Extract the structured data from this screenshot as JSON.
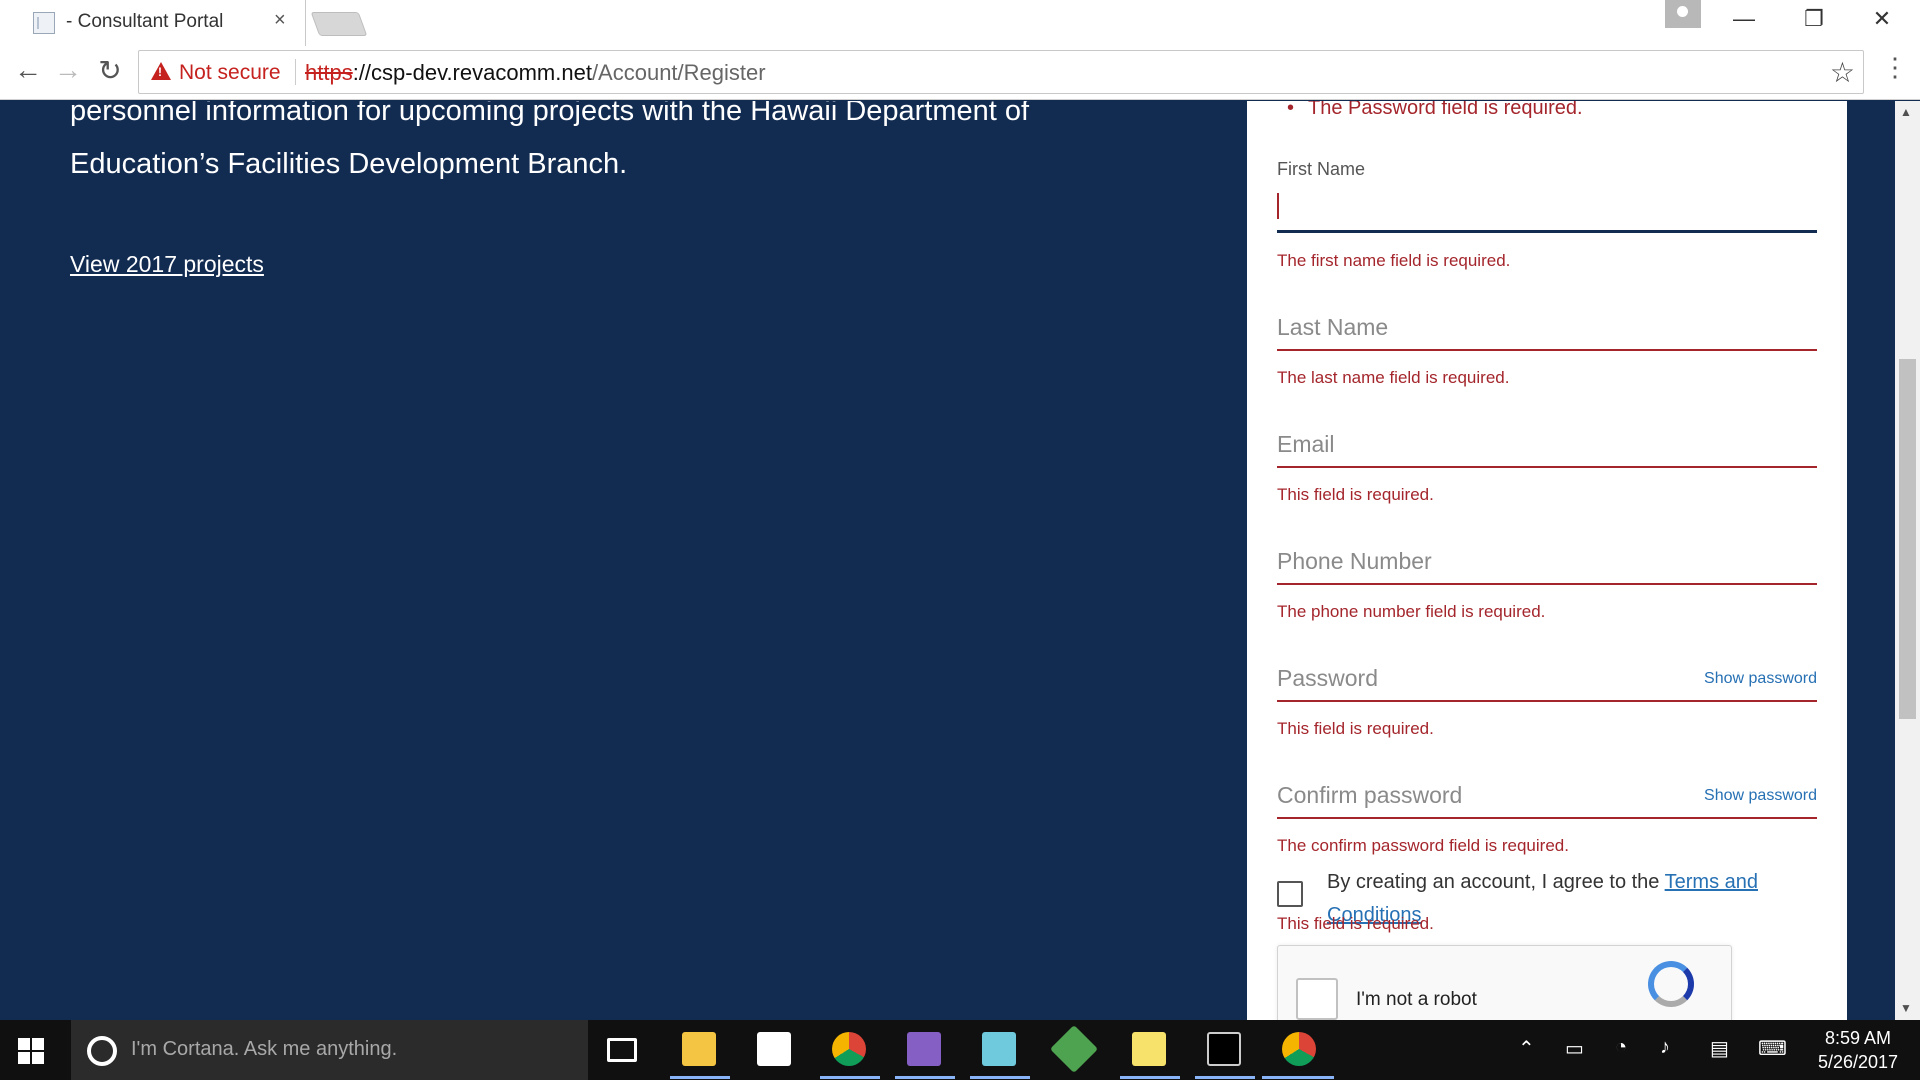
{
  "browser": {
    "tab_title": "- Consultant Portal",
    "tab_close": "×",
    "security_label": "Not secure",
    "url_scheme": "https",
    "url_host": "://csp-dev.revacomm.net",
    "url_path": "/Account/Register",
    "window_controls": {
      "minimize": "—",
      "restore": "❐",
      "close": "✕"
    }
  },
  "hero": {
    "text": "personnel information for upcoming projects with the Hawaii Department of Education’s Facilities Development Branch.",
    "link": "View 2017 projects"
  },
  "form": {
    "summary_error": "The Password field is required.",
    "first_name": {
      "label": "First Name",
      "error": "The first name field is required."
    },
    "last_name": {
      "placeholder": "Last Name",
      "error": "The last name field is required."
    },
    "email": {
      "placeholder": "Email",
      "error": "This field is required."
    },
    "phone": {
      "placeholder": "Phone Number",
      "error": "The phone number field is required."
    },
    "password": {
      "placeholder": "Password",
      "show": "Show password",
      "error": "This field is required."
    },
    "confirm_password": {
      "placeholder": "Confirm password",
      "show": "Show password",
      "error": "The confirm password field is required."
    },
    "terms": {
      "text": "By creating an account, I agree to the ",
      "link": "Terms and Conditions",
      "error": "This field is required."
    },
    "captcha": {
      "label": "I'm not a robot"
    }
  },
  "taskbar": {
    "cortana_placeholder": "I'm Cortana. Ask me anything.",
    "time": "8:59 AM",
    "date": "5/26/2017"
  },
  "colors": {
    "page_bg": "#122b51",
    "error": "#a4262c",
    "link": "#2670b4"
  }
}
